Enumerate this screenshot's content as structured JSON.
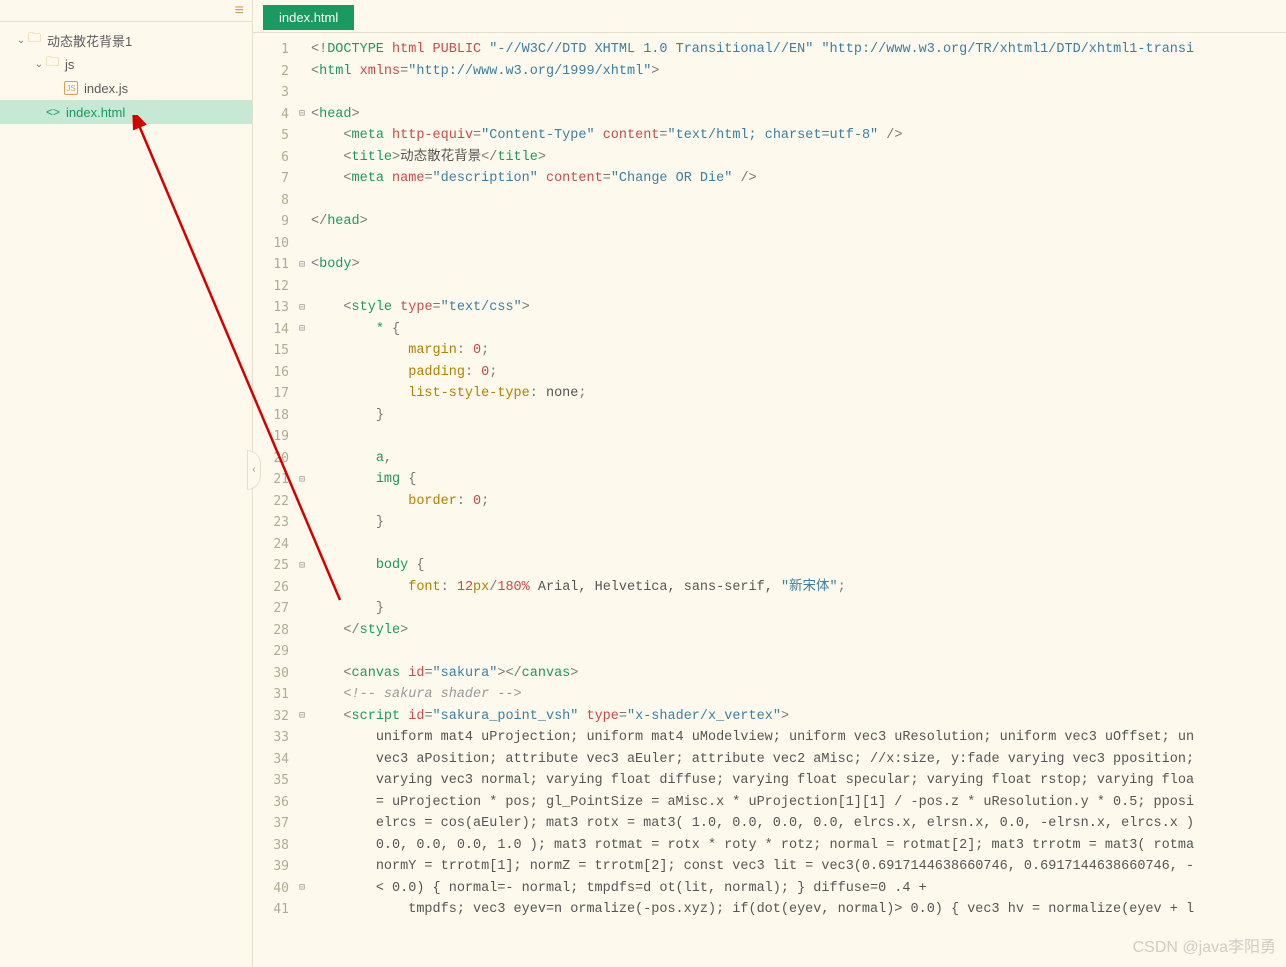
{
  "sidebar": {
    "items": [
      {
        "label": "动态散花背景1",
        "indent": 14,
        "type": "folder",
        "chevron": "⌄"
      },
      {
        "label": "js",
        "indent": 32,
        "type": "folder",
        "chevron": "⌄"
      },
      {
        "label": "index.js",
        "indent": 64,
        "type": "jsfile"
      },
      {
        "label": "index.html",
        "indent": 46,
        "type": "htmlfile",
        "selected": true
      }
    ]
  },
  "tab": {
    "label": "index.html"
  },
  "watermark": "CSDN @java李阳勇",
  "code": {
    "lines": [
      {
        "n": 1,
        "f": "",
        "html": "<span class='c-punc'>&lt;!</span><span class='c-tag'>DOCTYPE</span> <span class='c-attr'>html</span> <span class='c-attr'>PUBLIC</span> <span class='c-str'>\"-//W3C//DTD XHTML 1.0 Transitional//EN\"</span> <span class='c-str'>\"http://www.w3.org/TR/xhtml1/DTD/xhtml1-transi</span>"
      },
      {
        "n": 2,
        "f": "",
        "html": "<span class='c-punc'>&lt;</span><span class='c-tag'>html</span> <span class='c-attr'>xmlns</span><span class='c-punc'>=</span><span class='c-str'>\"http://www.w3.org/1999/xhtml\"</span><span class='c-punc'>&gt;</span>"
      },
      {
        "n": 3,
        "f": "",
        "html": ""
      },
      {
        "n": 4,
        "f": "⊟",
        "html": "<span class='c-punc'>&lt;</span><span class='c-tag'>head</span><span class='c-punc'>&gt;</span>"
      },
      {
        "n": 5,
        "f": "",
        "html": "    <span class='c-punc'>&lt;</span><span class='c-tag'>meta</span> <span class='c-attr'>http-equiv</span><span class='c-punc'>=</span><span class='c-str'>\"Content-Type\"</span> <span class='c-attr'>content</span><span class='c-punc'>=</span><span class='c-str'>\"text/html; charset=utf-8\"</span> <span class='c-punc'>/&gt;</span>"
      },
      {
        "n": 6,
        "f": "",
        "html": "    <span class='c-punc'>&lt;</span><span class='c-tag'>title</span><span class='c-punc'>&gt;</span><span class='c-text'>动态散花背景</span><span class='c-punc'>&lt;/</span><span class='c-tag'>title</span><span class='c-punc'>&gt;</span>"
      },
      {
        "n": 7,
        "f": "",
        "html": "    <span class='c-punc'>&lt;</span><span class='c-tag'>meta</span> <span class='c-attr'>name</span><span class='c-punc'>=</span><span class='c-str'>\"description\"</span> <span class='c-attr'>content</span><span class='c-punc'>=</span><span class='c-str'>\"Change OR Die\"</span> <span class='c-punc'>/&gt;</span>"
      },
      {
        "n": 8,
        "f": "",
        "html": ""
      },
      {
        "n": 9,
        "f": "",
        "html": "<span class='c-punc'>&lt;/</span><span class='c-tag'>head</span><span class='c-punc'>&gt;</span>"
      },
      {
        "n": 10,
        "f": "",
        "html": ""
      },
      {
        "n": 11,
        "f": "⊟",
        "html": "<span class='c-punc'>&lt;</span><span class='c-tag'>body</span><span class='c-punc'>&gt;</span>"
      },
      {
        "n": 12,
        "f": "",
        "html": ""
      },
      {
        "n": 13,
        "f": "⊟",
        "html": "    <span class='c-punc'>&lt;</span><span class='c-tag'>style</span> <span class='c-attr'>type</span><span class='c-punc'>=</span><span class='c-str'>\"text/css\"</span><span class='c-punc'>&gt;</span>"
      },
      {
        "n": 14,
        "f": "⊟",
        "html": "        <span class='c-tag'>*</span> <span class='c-punc'>{</span>"
      },
      {
        "n": 15,
        "f": "",
        "html": "            <span class='c-prop'>margin</span><span class='c-punc'>:</span> <span class='c-num'>0</span><span class='c-punc'>;</span>"
      },
      {
        "n": 16,
        "f": "",
        "html": "            <span class='c-prop'>padding</span><span class='c-punc'>:</span> <span class='c-num'>0</span><span class='c-punc'>;</span>"
      },
      {
        "n": 17,
        "f": "",
        "html": "            <span class='c-prop'>list-style-type</span><span class='c-punc'>:</span> <span class='c-text'>none</span><span class='c-punc'>;</span>"
      },
      {
        "n": 18,
        "f": "",
        "html": "        <span class='c-punc'>}</span>"
      },
      {
        "n": 19,
        "f": "",
        "html": ""
      },
      {
        "n": 20,
        "f": "",
        "html": "        <span class='c-tag'>a</span><span class='c-punc'>,</span>"
      },
      {
        "n": 21,
        "f": "⊟",
        "html": "        <span class='c-tag'>img</span> <span class='c-punc'>{</span>"
      },
      {
        "n": 22,
        "f": "",
        "html": "            <span class='c-prop'>border</span><span class='c-punc'>:</span> <span class='c-num'>0</span><span class='c-punc'>;</span>"
      },
      {
        "n": 23,
        "f": "",
        "html": "        <span class='c-punc'>}</span>"
      },
      {
        "n": 24,
        "f": "",
        "html": ""
      },
      {
        "n": 25,
        "f": "⊟",
        "html": "        <span class='c-tag'>body</span> <span class='c-punc'>{</span>"
      },
      {
        "n": 26,
        "f": "",
        "html": "            <span class='c-prop'>font</span><span class='c-punc'>:</span> <span class='c-num'>12</span><span class='c-unit'>px</span><span class='c-punc'>/</span><span class='c-num'>180</span><span class='c-pct'>%</span> <span class='c-text'>Arial, Helvetica, sans-serif,</span> <span class='c-str'>\"新宋体\"</span><span class='c-punc'>;</span>"
      },
      {
        "n": 27,
        "f": "",
        "html": "        <span class='c-punc'>}</span>"
      },
      {
        "n": 28,
        "f": "",
        "html": "    <span class='c-punc'>&lt;/</span><span class='c-tag'>style</span><span class='c-punc'>&gt;</span>"
      },
      {
        "n": 29,
        "f": "",
        "html": ""
      },
      {
        "n": 30,
        "f": "",
        "html": "    <span class='c-punc'>&lt;</span><span class='c-tag'>canvas</span> <span class='c-attr'>id</span><span class='c-punc'>=</span><span class='c-str'>\"sakura\"</span><span class='c-punc'>&gt;&lt;/</span><span class='c-tag'>canvas</span><span class='c-punc'>&gt;</span>"
      },
      {
        "n": 31,
        "f": "",
        "html": "    <span class='c-comment'>&lt;!-- sakura shader --&gt;</span>"
      },
      {
        "n": 32,
        "f": "⊟",
        "html": "    <span class='c-punc'>&lt;</span><span class='c-tag'>script</span> <span class='c-attr'>id</span><span class='c-punc'>=</span><span class='c-str'>\"sakura_point_vsh\"</span> <span class='c-attr'>type</span><span class='c-punc'>=</span><span class='c-str'>\"x-shader/x_vertex\"</span><span class='c-punc'>&gt;</span>"
      },
      {
        "n": 33,
        "f": "",
        "html": "        <span class='c-text'>uniform mat4 uProjection; uniform mat4 uModelview; uniform vec3 uResolution; uniform vec3 uOffset; un</span>"
      },
      {
        "n": 34,
        "f": "",
        "html": "        <span class='c-text'>vec3 aPosition; attribute vec3 aEuler; attribute vec2 aMisc; //x:size, y:fade varying vec3 pposition;</span>"
      },
      {
        "n": 35,
        "f": "",
        "html": "        <span class='c-text'>varying vec3 normal; varying float diffuse; varying float specular; varying float rstop; varying floa</span>"
      },
      {
        "n": 36,
        "f": "",
        "html": "        <span class='c-text'>= uProjection * pos; gl_PointSize = aMisc.x * uProjection[1][1] / -pos.z * uResolution.y * 0.5; pposi</span>"
      },
      {
        "n": 37,
        "f": "",
        "html": "        <span class='c-text'>elrcs = cos(aEuler); mat3 rotx = mat3( 1.0, 0.0, 0.0, 0.0, elrcs.x, elrsn.x, 0.0, -elrsn.x, elrcs.x )</span>"
      },
      {
        "n": 38,
        "f": "",
        "html": "        <span class='c-text'>0.0, 0.0, 0.0, 1.0 ); mat3 rotmat = rotx * roty * rotz; normal = rotmat[2]; mat3 trrotm = mat3( rotma</span>"
      },
      {
        "n": 39,
        "f": "",
        "html": "        <span class='c-text'>normY = trrotm[1]; normZ = trrotm[2]; const vec3 lit = vec3(0.6917144638660746, 0.6917144638660746, -</span>"
      },
      {
        "n": 40,
        "f": "⊟",
        "html": "        <span class='c-text'>&lt; 0.0) { normal=- normal; tmpdfs=d ot(lit, normal); } diffuse=0 .4 +</span>"
      },
      {
        "n": 41,
        "f": "",
        "html": "            <span class='c-text'>tmpdfs; vec3 eyev=n ormalize(-pos.xyz); if(dot(eyev, normal)&gt; 0.0) { vec3 hv = normalize(eyev + l</span>"
      }
    ]
  }
}
